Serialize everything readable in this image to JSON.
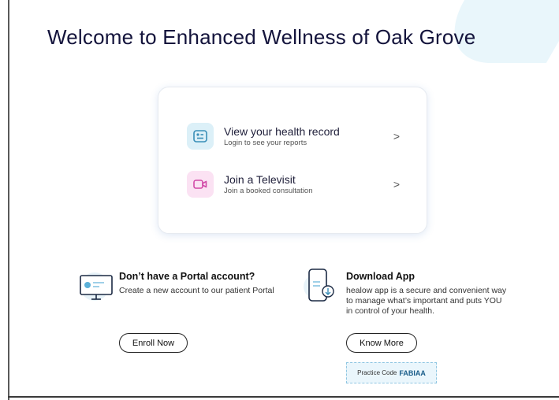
{
  "page": {
    "title": "Welcome to Enhanced Wellness of Oak Grove"
  },
  "card": {
    "options": [
      {
        "title": "View your health record",
        "subtitle": "Login to see your reports",
        "icon": "health-record-icon",
        "color": "#dcf0f8"
      },
      {
        "title": "Join a Televisit",
        "subtitle": "Join a booked consultation",
        "icon": "video-camera-icon",
        "color": "#fbe2f3"
      }
    ],
    "chevron": ">"
  },
  "portal": {
    "title": "Don’t have a Portal account?",
    "body": "Create a new account to our patient Portal",
    "button": "Enroll Now",
    "icon": "computer-monitor-icon"
  },
  "app": {
    "title": "Download App",
    "body": "healow app is a secure and convenient way to manage what’s important and puts YOU in control of your health.",
    "button": "Know More",
    "icon": "mobile-download-icon",
    "practice_label": "Practice Code",
    "practice_code": "FABIAA"
  }
}
